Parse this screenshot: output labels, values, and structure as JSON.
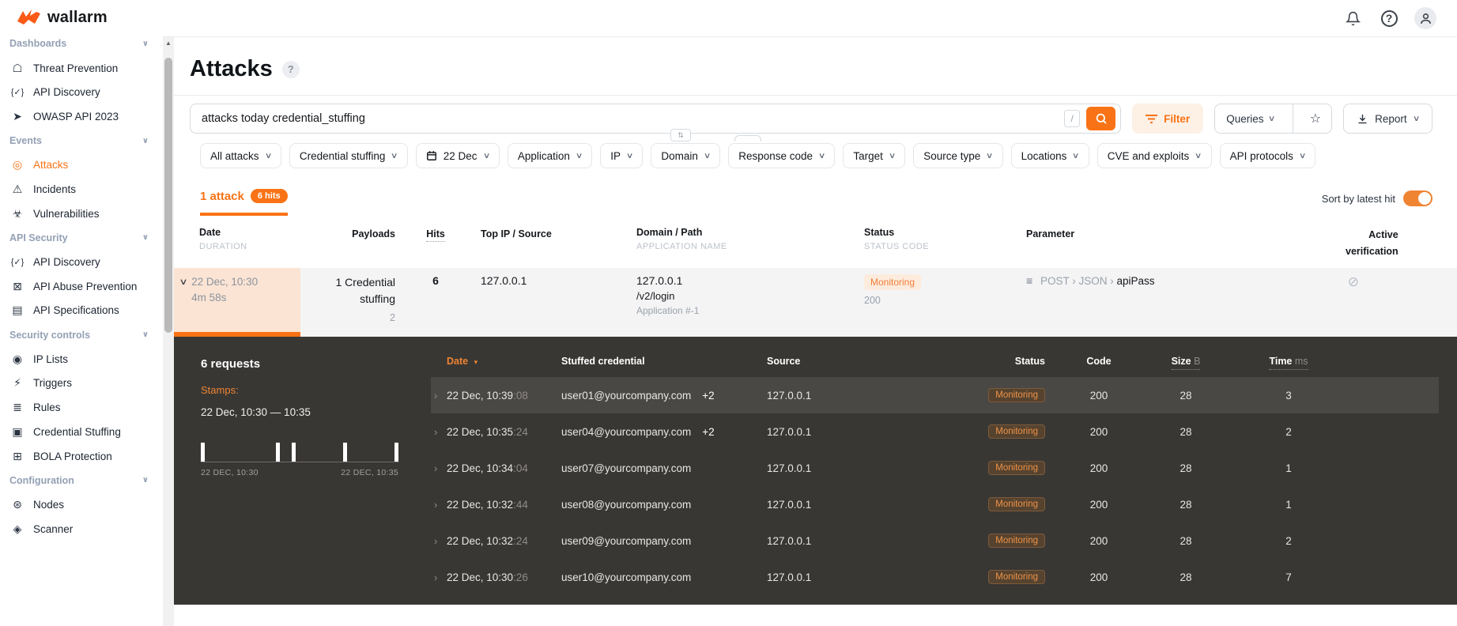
{
  "ui": {
    "caret": "∨",
    "sep": "›",
    "sort_desc": "▾",
    "row_chevron": "›",
    "expand_chevron": "∨",
    "scroll_up": "▲",
    "no_verify_icon": "⊘",
    "param_icon": "≡",
    "updown_icon": "⇅",
    "help_icon": "?",
    "star_icon": "☆"
  },
  "brand": {
    "name": "wallarm",
    "logo_color": "#fb5a16"
  },
  "sidebar": {
    "entries": [
      {
        "type": "section",
        "label": "Dashboards"
      },
      {
        "type": "item",
        "icon": "☖",
        "icon_name": "shield-icon",
        "label": "Threat Prevention"
      },
      {
        "type": "item",
        "icon": "{✓}",
        "icon_name": "braces-check-icon",
        "label": "API Discovery"
      },
      {
        "type": "item",
        "icon": "➤",
        "icon_name": "paper-plane-icon",
        "label": "OWASP API 2023"
      },
      {
        "type": "section",
        "label": "Events"
      },
      {
        "type": "item",
        "icon": "◎",
        "icon_name": "target-icon",
        "label": "Attacks",
        "active": true
      },
      {
        "type": "item",
        "icon": "⚠",
        "icon_name": "warning-triangle-icon",
        "label": "Incidents"
      },
      {
        "type": "item",
        "icon": "☣",
        "icon_name": "biohazard-icon",
        "label": "Vulnerabilities"
      },
      {
        "type": "section",
        "label": "API Security"
      },
      {
        "type": "item",
        "icon": "{✓}",
        "icon_name": "braces-check-icon",
        "label": "API Discovery"
      },
      {
        "type": "item",
        "icon": "⊠",
        "icon_name": "robot-off-icon",
        "label": "API Abuse Prevention"
      },
      {
        "type": "item",
        "icon": "▤",
        "icon_name": "document-icon",
        "label": "API Specifications"
      },
      {
        "type": "section",
        "label": "Security controls"
      },
      {
        "type": "item",
        "icon": "◉",
        "icon_name": "ip-circle-icon",
        "label": "IP Lists"
      },
      {
        "type": "item",
        "icon": "⚡",
        "icon_name": "lightning-icon",
        "label": "Triggers"
      },
      {
        "type": "item",
        "icon": "≣",
        "icon_name": "checklist-icon",
        "label": "Rules"
      },
      {
        "type": "item",
        "icon": "▣",
        "icon_name": "id-card-icon",
        "label": "Credential Stuffing"
      },
      {
        "type": "item",
        "icon": "⊞",
        "icon_name": "id-braces-icon",
        "label": "BOLA Protection"
      },
      {
        "type": "section",
        "label": "Configuration"
      },
      {
        "type": "item",
        "icon": "⊛",
        "icon_name": "nodes-icon",
        "label": "Nodes"
      },
      {
        "type": "item",
        "icon": "◈",
        "icon_name": "scanner-icon",
        "label": "Scanner"
      }
    ]
  },
  "page": {
    "title": "Attacks"
  },
  "search": {
    "value": "attacks today credential_stuffing",
    "shortcut": "/"
  },
  "actions": {
    "filter": "Filter",
    "queries": "Queries",
    "report": "Report"
  },
  "filters": {
    "chips": [
      {
        "label": "All attacks"
      },
      {
        "label": "Credential stuffing"
      },
      {
        "label": "22 Dec",
        "calendar": true
      },
      {
        "label": "Application"
      },
      {
        "label": "IP"
      },
      {
        "label": "Domain"
      },
      {
        "label": "Response code"
      },
      {
        "label": "Target"
      },
      {
        "label": "Source type"
      },
      {
        "label": "Locations"
      },
      {
        "label": "CVE and exploits"
      },
      {
        "label": "API protocols"
      }
    ]
  },
  "results": {
    "count_label": "1 attack",
    "hits_badge": "6 hits",
    "sort_label": "Sort by latest hit",
    "sort_on": true
  },
  "attacks_table": {
    "headers": {
      "date": "Date",
      "date_sub": "DURATION",
      "payloads": "Payloads",
      "hits": "Hits",
      "top_ip": "Top IP / Source",
      "domain": "Domain / Path",
      "domain_sub": "APPLICATION NAME",
      "status": "Status",
      "status_sub": "STATUS CODE",
      "parameter": "Parameter",
      "active_verification": "Active verification"
    },
    "row": {
      "date": "22 Dec, 10:30",
      "duration": "4m 58s",
      "payloads": "1 Credential stuffing",
      "payloads_sub": "2",
      "hits": "6",
      "top_ip": "127.0.0.1",
      "domain": "127.0.0.1",
      "path": "/v2/login",
      "app_name": "Application #-1",
      "status": "Monitoring",
      "status_code": "200",
      "param_method": "POST",
      "param_loc": "JSON",
      "param_name": "apiPass"
    }
  },
  "details": {
    "requests_label": "6 requests",
    "stamps_label": "Stamps:",
    "stamps_range": "22 Dec, 10:30 — 10:35",
    "histogram": {
      "type": "bar",
      "axis_start": "22 DEC, 10:30",
      "axis_end": "22 DEC, 10:35",
      "bars_pct": [
        0,
        38,
        46,
        72,
        98
      ]
    },
    "table": {
      "headers": {
        "date": "Date",
        "credential": "Stuffed credential",
        "source": "Source",
        "status": "Status",
        "code": "Code",
        "size": "Size",
        "size_unit": "B",
        "time": "Time",
        "time_unit": "ms"
      },
      "rows": [
        {
          "date": "22 Dec, 10:39",
          "seconds": ":08",
          "credential": "user01@yourcompany.com",
          "extra": "+2",
          "source": "127.0.0.1",
          "status": "Monitoring",
          "code": "200",
          "size": "28",
          "time": "3"
        },
        {
          "date": "22 Dec, 10:35",
          "seconds": ":24",
          "credential": "user04@yourcompany.com",
          "extra": "+2",
          "source": "127.0.0.1",
          "status": "Monitoring",
          "code": "200",
          "size": "28",
          "time": "2"
        },
        {
          "date": "22 Dec, 10:34",
          "seconds": ":04",
          "credential": "user07@yourcompany.com",
          "extra": "",
          "source": "127.0.0.1",
          "status": "Monitoring",
          "code": "200",
          "size": "28",
          "time": "1"
        },
        {
          "date": "22 Dec, 10:32",
          "seconds": ":44",
          "credential": "user08@yourcompany.com",
          "extra": "",
          "source": "127.0.0.1",
          "status": "Monitoring",
          "code": "200",
          "size": "28",
          "time": "1"
        },
        {
          "date": "22 Dec, 10:32",
          "seconds": ":24",
          "credential": "user09@yourcompany.com",
          "extra": "",
          "source": "127.0.0.1",
          "status": "Monitoring",
          "code": "200",
          "size": "28",
          "time": "2"
        },
        {
          "date": "22 Dec, 10:30",
          "seconds": ":26",
          "credential": "user10@yourcompany.com",
          "extra": "",
          "source": "127.0.0.1",
          "status": "Monitoring",
          "code": "200",
          "size": "28",
          "time": "7"
        }
      ]
    }
  }
}
